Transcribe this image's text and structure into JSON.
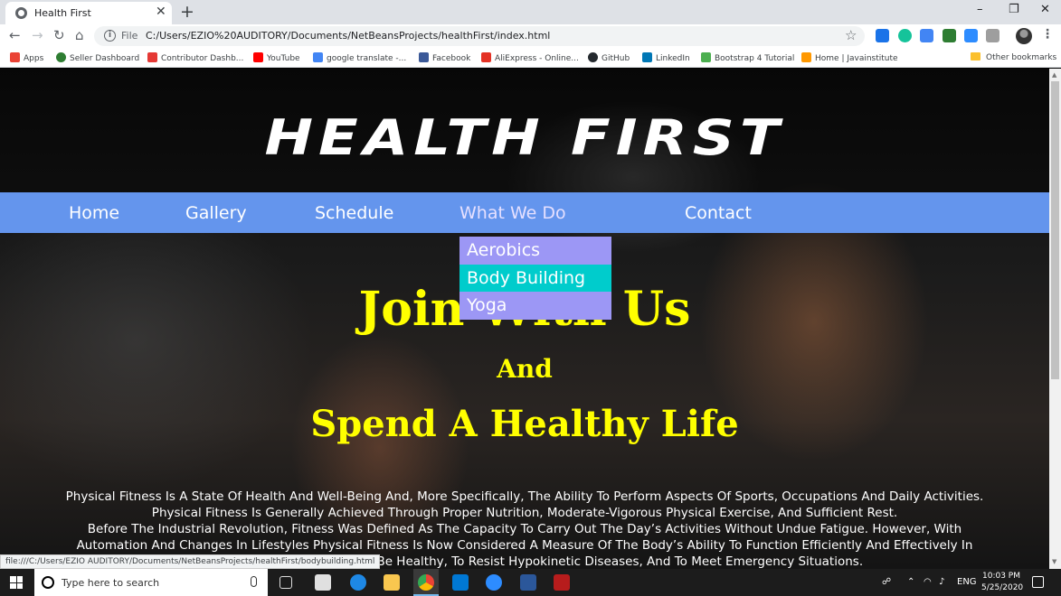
{
  "browser": {
    "tab_title": "Health First",
    "url_scheme": "File",
    "url": "C:/Users/EZIO%20AUDITORY/Documents/NetBeansProjects/healthFirst/index.html",
    "bookmarks": [
      {
        "label": "Apps",
        "color": "#ea4335"
      },
      {
        "label": "Seller Dashboard",
        "color": "#2e7d32"
      },
      {
        "label": "Contributor Dashb...",
        "color": "#e53935"
      },
      {
        "label": "YouTube",
        "color": "#ff0000"
      },
      {
        "label": "google translate -...",
        "color": "#4285f4"
      },
      {
        "label": "Facebook",
        "color": "#3b5998"
      },
      {
        "label": "AliExpress - Online...",
        "color": "#e43225"
      },
      {
        "label": "GitHub",
        "color": "#24292e"
      },
      {
        "label": "LinkedIn",
        "color": "#0077b5"
      },
      {
        "label": "Bootstrap 4 Tutorial",
        "color": "#4caf50"
      },
      {
        "label": "Home | Javainstitute",
        "color": "#ff9800"
      }
    ],
    "other_bookmarks": "Other bookmarks",
    "status_url": "file:///C:/Users/EZIO AUDITORY/Documents/NetBeansProjects/healthFirst/bodybuilding.html"
  },
  "site": {
    "logo": "HEALTH FIRST",
    "nav": [
      {
        "label": "Home"
      },
      {
        "label": "Gallery"
      },
      {
        "label": "Schedule"
      },
      {
        "label": "What We Do"
      },
      {
        "label": "Contact"
      }
    ],
    "dropdown": [
      {
        "label": "Aerobics"
      },
      {
        "label": "Body Building"
      },
      {
        "label": "Yoga"
      }
    ],
    "headline_1": "Join With Us",
    "headline_2": "And",
    "headline_3": "Spend A Healthy Life",
    "paragraph_1": "Physical Fitness Is A State Of Health And Well-Being And, More Specifically, The Ability To Perform Aspects Of Sports, Occupations And Daily Activities. Physical Fitness Is Generally Achieved Through Proper Nutrition, Moderate-Vigorous Physical Exercise, And Sufficient Rest.",
    "paragraph_2": "Before The Industrial Revolution, Fitness Was Defined As The Capacity To Carry Out The Day’s Activities Without Undue Fatigue. However, With Automation And Changes In Lifestyles Physical Fitness Is Now Considered A Measure Of The Body’s Ability To Function Efficiently And Effectively In Work And Leisure Activities, To Be Healthy, To Resist Hypokinetic Diseases, And To Meet Emergency Situations.",
    "colors": {
      "nav_bg": "#6495ed",
      "dropdown_bg": "#9c97f5",
      "dropdown_hover": "#00cccc",
      "headline": "#ffff00"
    }
  },
  "taskbar": {
    "search_placeholder": "Type here to search",
    "language": "ENG",
    "time": "10:03 PM",
    "date": "5/25/2020"
  }
}
